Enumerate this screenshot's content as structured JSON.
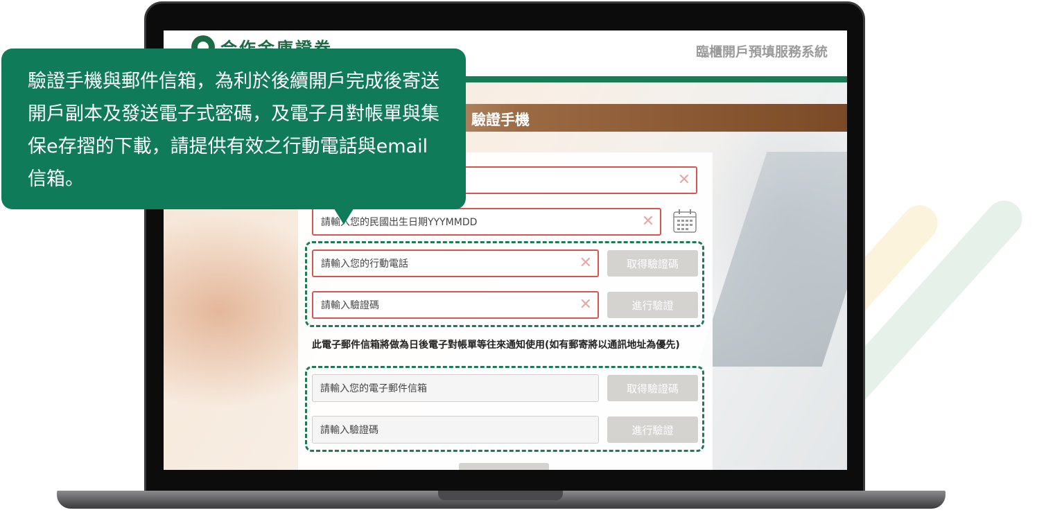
{
  "header": {
    "logo_text": "合作金庫證券",
    "system_name": "臨櫃開戶預填服務系統"
  },
  "section": {
    "title": "驗證手機"
  },
  "callout": {
    "text": "驗證手機與郵件信箱，為利於後續開戶完成後寄送開戶副本及發送電子式密碼，及電子月對帳單與集保e存摺的下載，請提供有效之行動電話與email信箱。"
  },
  "form": {
    "birthdate_placeholder": "請輸入您的民國出生日期YYYMMDD",
    "mobile_placeholder": "請輸入您的行動電話",
    "mobile_code_placeholder": "請輸入驗證碼",
    "get_code_label": "取得驗證碼",
    "verify_label": "進行驗證",
    "email_note": "此電子郵件信箱將做為日後電子對帳單等往來通知使用(如有郵寄將以通訊地址為優先)",
    "email_placeholder": "請輸入您的電子郵件信箱",
    "email_code_placeholder": "請輸入驗證碼",
    "email_get_code_label": "取得驗證碼",
    "email_verify_label": "進行驗證"
  },
  "colors": {
    "brand_green": "#1c7a57",
    "error_red": "#d9534f",
    "button_gray": "#d5d3d0",
    "title_brown": "#7a4a26"
  }
}
